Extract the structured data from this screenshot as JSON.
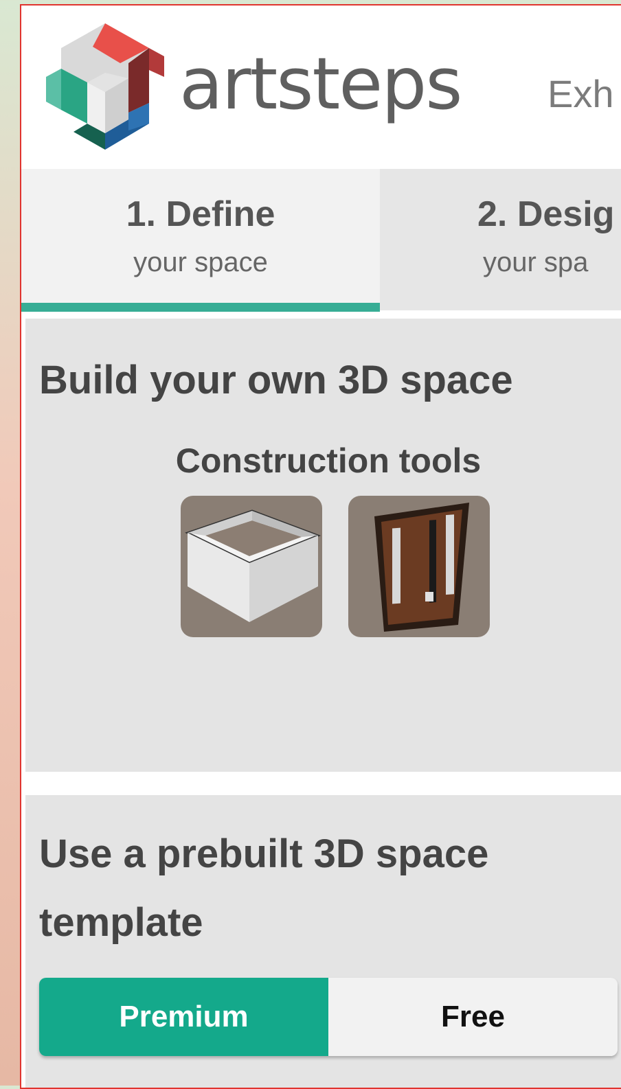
{
  "header": {
    "brand": "artsteps",
    "extra": "Exh"
  },
  "tabs": [
    {
      "title": "1. Define",
      "subtitle": "your space",
      "active": true
    },
    {
      "title": "2. Desig",
      "subtitle": "your spa",
      "active": false
    }
  ],
  "build": {
    "title": "Build your own 3D space",
    "tools_title": "Construction tools",
    "tools": [
      {
        "icon": "walls-icon"
      },
      {
        "icon": "door-icon"
      }
    ]
  },
  "template": {
    "title": "Use a prebuilt 3D space template",
    "options": [
      "Premium",
      "Free"
    ],
    "selected": "Premium"
  },
  "colors": {
    "accent": "#14a98b",
    "tab_indicator": "#37ad95",
    "frame_border": "#e0342f"
  }
}
